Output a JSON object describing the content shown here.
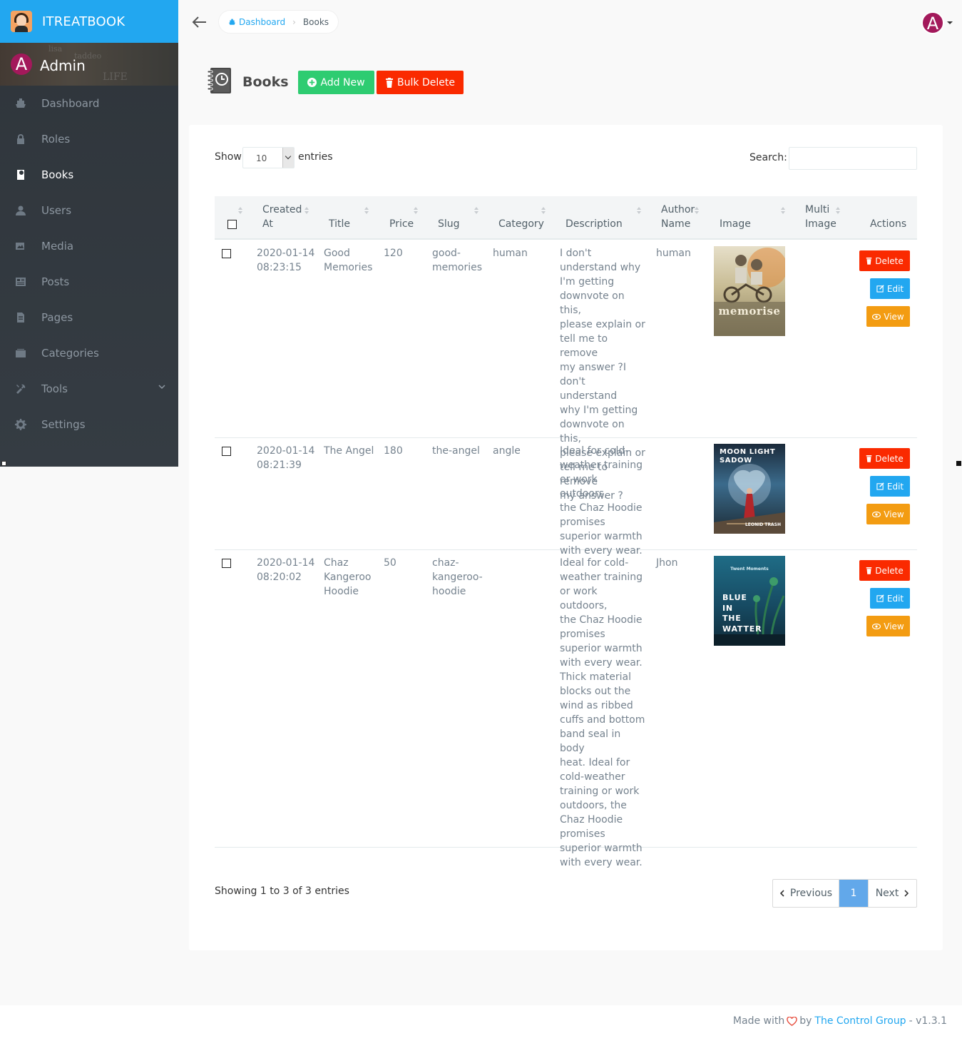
{
  "brand": {
    "title": "ITREATBOOK"
  },
  "user": {
    "name": "Admin",
    "avatar_letter": "A"
  },
  "sidebar": {
    "items": [
      {
        "label": "Dashboard",
        "icon": "boat-icon"
      },
      {
        "label": "Roles",
        "icon": "lock-icon"
      },
      {
        "label": "Books",
        "icon": "book-icon",
        "active": true
      },
      {
        "label": "Users",
        "icon": "person-icon"
      },
      {
        "label": "Media",
        "icon": "images-icon"
      },
      {
        "label": "Posts",
        "icon": "news-icon"
      },
      {
        "label": "Pages",
        "icon": "file-text-icon"
      },
      {
        "label": "Categories",
        "icon": "categories-icon"
      },
      {
        "label": "Tools",
        "icon": "tools-icon",
        "has_submenu": true
      },
      {
        "label": "Settings",
        "icon": "gear-icon"
      }
    ]
  },
  "topbar": {
    "breadcrumb": {
      "home": "Dashboard",
      "current": "Books"
    },
    "avatar_letter": "A"
  },
  "page": {
    "title": "Books",
    "add_label": "Add New",
    "bulk_delete_label": "Bulk Delete"
  },
  "table_controls": {
    "show_label": "Show",
    "page_length": "10",
    "entries_label": "entries",
    "search_label": "Search:",
    "search_value": ""
  },
  "table": {
    "columns": {
      "created_at_1": "Created",
      "created_at_2": "At",
      "title": "Title",
      "price": "Price",
      "slug": "Slug",
      "category": "Category",
      "description": "Description",
      "author_1": "Author",
      "author_2": "Name",
      "image": "Image",
      "multi_1": "Multi",
      "multi_2": "Image",
      "actions": "Actions"
    },
    "rows": [
      {
        "created_date": "2020-01-14",
        "created_time": "08:23:15",
        "title_1": "Good",
        "title_2": "Memories",
        "price": "120",
        "slug_1": "good-",
        "slug_2": "memories",
        "category": "human",
        "description": [
          "I don't",
          "understand why",
          "I'm getting",
          "downvote on this,",
          "please explain or",
          "tell me to remove",
          "my answer ?I",
          "don't understand",
          "why I'm getting",
          "downvote on this,",
          "please explain or",
          "tell me to remove",
          "my answer ?"
        ],
        "author": "human",
        "cover_text": "memorise",
        "delete_label": "Delete",
        "edit_label": "Edit",
        "view_label": "View"
      },
      {
        "created_date": "2020-01-14",
        "created_time": "08:21:39",
        "title_1": "The Angel",
        "price": "180",
        "slug_1": "the-angel",
        "category": "angle",
        "description": [
          "Ideal for cold-",
          "weather training",
          "or work outdoors,",
          "the Chaz Hoodie",
          "promises",
          "superior warmth",
          "with every wear."
        ],
        "author": "",
        "cover_text_1": "MOON LIGHT",
        "cover_text_2": "SADOW",
        "cover_author": "LEONID TRASH",
        "delete_label": "Delete",
        "edit_label": "Edit",
        "view_label": "View"
      },
      {
        "created_date": "2020-01-14",
        "created_time": "08:20:02",
        "title_1": "Chaz",
        "title_2": "Kangeroo",
        "title_3": "Hoodie",
        "price": "50",
        "slug_1": "chaz-",
        "slug_2": "kangeroo-",
        "slug_3": "hoodie",
        "category": "",
        "description": [
          "Ideal for cold-",
          "weather training",
          "or work outdoors,",
          "the Chaz Hoodie",
          "promises",
          "superior warmth",
          "with every wear.",
          "Thick material",
          "blocks out the",
          "wind as ribbed",
          "cuffs and bottom",
          "band seal in body",
          "heat. Ideal for",
          "cold-weather",
          "training or work",
          "outdoors, the",
          "Chaz Hoodie",
          "promises",
          "superior warmth",
          "with every wear."
        ],
        "author": "Jhon",
        "cover_top": "Twent Moments",
        "cover_lines": [
          "BLUE",
          "IN",
          "THE",
          "WATTER"
        ],
        "delete_label": "Delete",
        "edit_label": "Edit",
        "view_label": "View"
      }
    ]
  },
  "pagination": {
    "info": "Showing 1 to 3 of 3 entries",
    "previous": "Previous",
    "current": "1",
    "next": "Next"
  },
  "footer": {
    "made_with": "Made with",
    "by": "by",
    "company": "The Control Group",
    "version": "- v1.3.1"
  },
  "colors": {
    "brand_bar": "#22a7f0",
    "sidebar": "#2f353b",
    "add_button": "#2ecc71",
    "delete_button": "#fa2a00",
    "edit_button": "#22a7f0",
    "view_button": "#f39c12",
    "active_page": "#62a8ea",
    "avatar": "#a3195b"
  }
}
